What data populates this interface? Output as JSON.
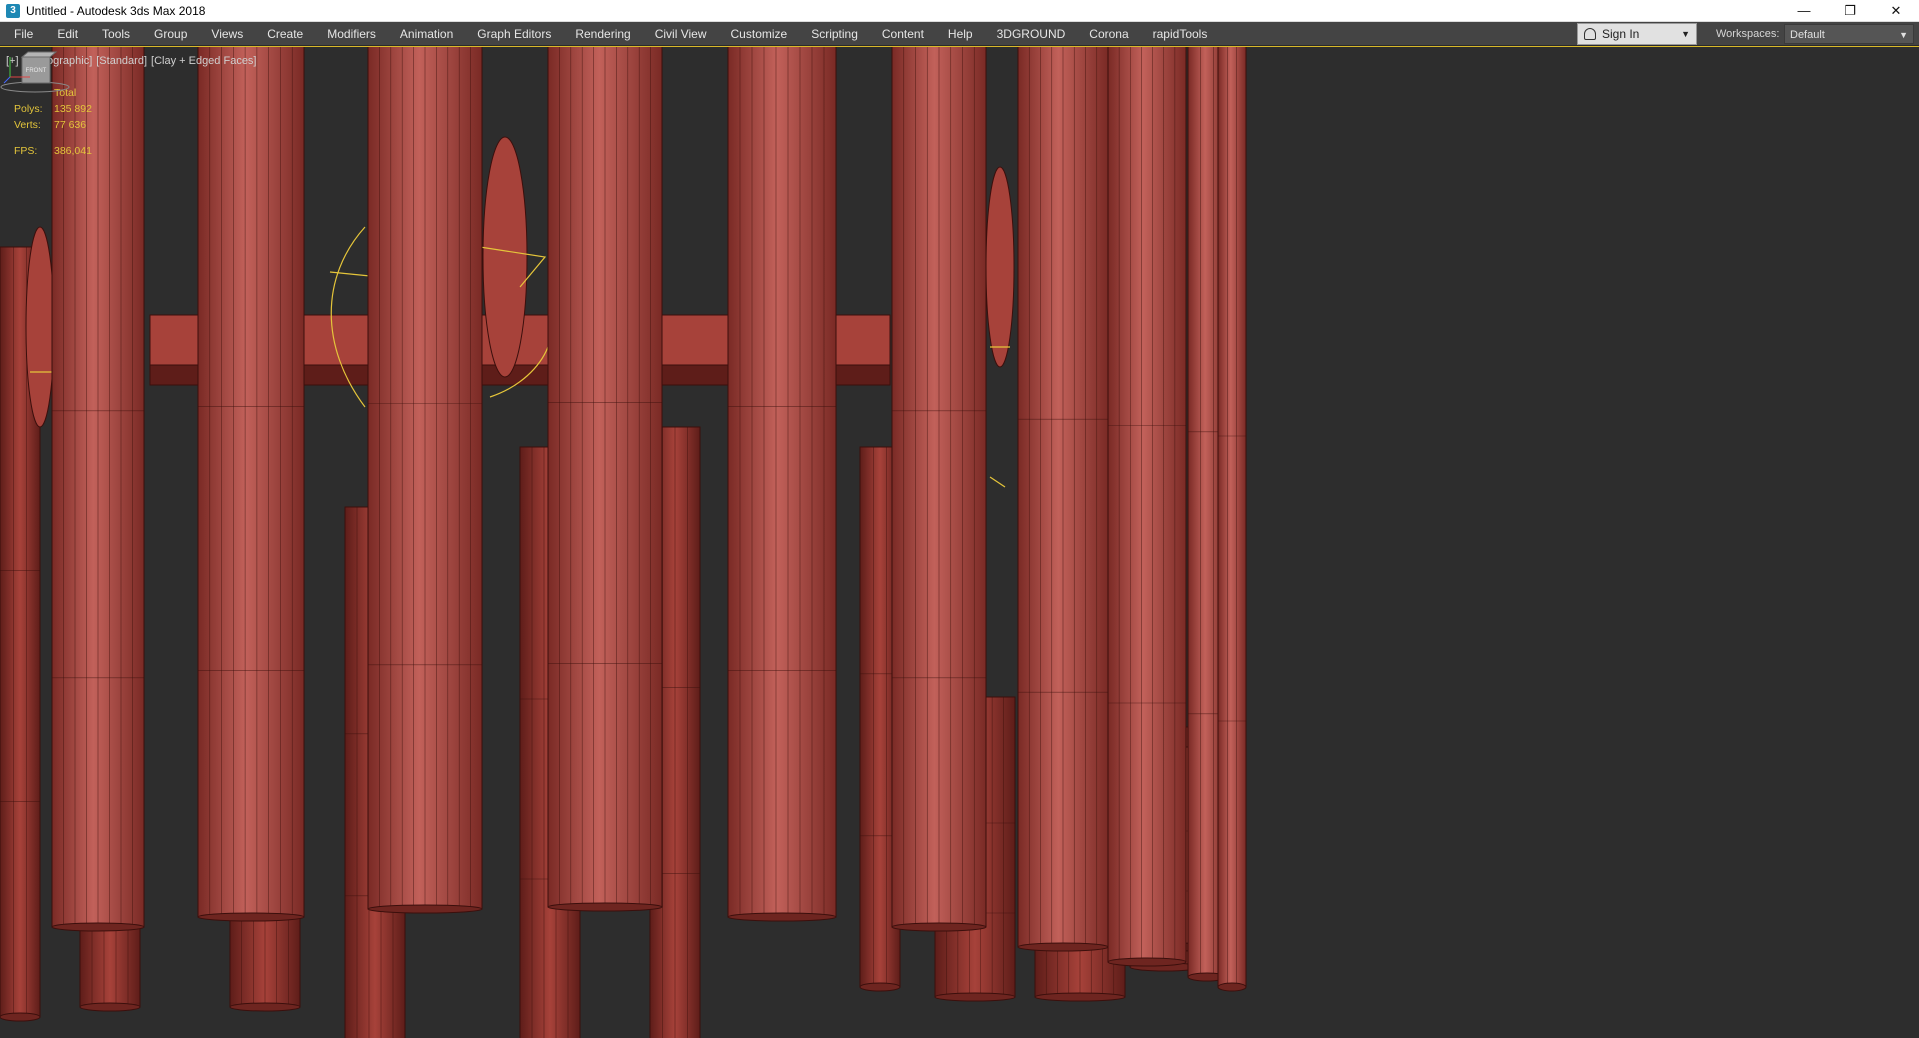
{
  "titlebar": {
    "title": "Untitled - Autodesk 3ds Max 2018",
    "icon": "3ds-max-app-icon",
    "minimize_glyph": "—",
    "restore_glyph": "❐",
    "close_glyph": "✕"
  },
  "menubar": {
    "items": [
      "File",
      "Edit",
      "Tools",
      "Group",
      "Views",
      "Create",
      "Modifiers",
      "Animation",
      "Graph Editors",
      "Rendering",
      "Civil View",
      "Customize",
      "Scripting",
      "Content",
      "Help",
      "3DGROUND",
      "Corona",
      "rapidTools"
    ],
    "signin_label": "Sign In",
    "workspaces_label": "Workspaces:",
    "workspace_value": "Default"
  },
  "viewport": {
    "label_plus": "[+]",
    "label_view": "[Orthographic]",
    "label_shading": "[Standard]",
    "label_mode": "[Clay + Edged Faces]",
    "stats": {
      "header": "Total",
      "polys_label": "Polys:",
      "polys_value": "135 892",
      "verts_label": "Verts:",
      "verts_value": "77 636",
      "fps_label": "FPS:",
      "fps_value": "386,041"
    },
    "viewcube_label": "FRONT",
    "colors": {
      "background": "#2d2d2d",
      "clay_dark": "#7a2a25",
      "clay_mid": "#a7423a",
      "clay_light": "#c2615a",
      "edge": "#3b0f0c",
      "selection": "#e5c53a"
    }
  }
}
